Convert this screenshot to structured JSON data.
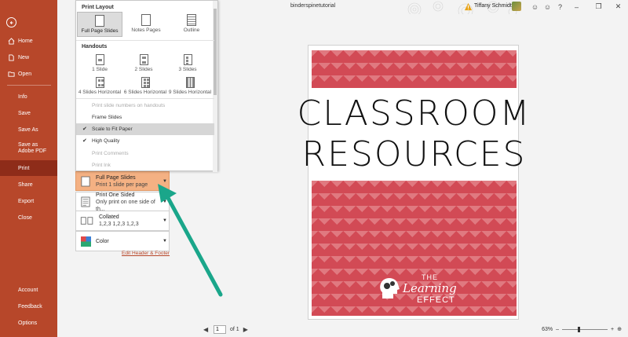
{
  "window": {
    "title": "binderspinetutorial",
    "user_name": "Tiffany Schmidt"
  },
  "sidebar": {
    "items": [
      {
        "label": "Home",
        "icon": "home-icon"
      },
      {
        "label": "New",
        "icon": "new-file-icon"
      },
      {
        "label": "Open",
        "icon": "folder-open-icon"
      },
      {
        "label": "Info"
      },
      {
        "label": "Save"
      },
      {
        "label": "Save As"
      },
      {
        "label": "Save as Adobe PDF"
      },
      {
        "label": "Print"
      },
      {
        "label": "Share"
      },
      {
        "label": "Export"
      },
      {
        "label": "Close"
      },
      {
        "label": "Account"
      },
      {
        "label": "Feedback"
      },
      {
        "label": "Options"
      }
    ],
    "active": "Print"
  },
  "dropdown": {
    "print_layout_heading": "Print Layout",
    "layouts": [
      "Full Page Slides",
      "Notes Pages",
      "Outline"
    ],
    "selected_layout": "Full Page Slides",
    "handouts_heading": "Handouts",
    "handouts": [
      "1 Slide",
      "2 Slides",
      "3 Slides",
      "4 Slides Horizontal",
      "6 Slides Horizontal",
      "9 Slides Horizontal"
    ],
    "options": [
      {
        "label": "Print slide numbers on handouts",
        "enabled": false,
        "checked": false
      },
      {
        "label": "Frame Slides",
        "enabled": true,
        "checked": false
      },
      {
        "label": "Scale to Fit Paper",
        "enabled": true,
        "checked": true,
        "highlighted": true
      },
      {
        "label": "High Quality",
        "enabled": true,
        "checked": true
      },
      {
        "label": "Print Comments",
        "enabled": false,
        "checked": false
      },
      {
        "label": "Print Ink",
        "enabled": false,
        "checked": false
      }
    ]
  },
  "settings": {
    "layout": {
      "title": "Full Page Slides",
      "sub": "Print 1 slide per page"
    },
    "sides": {
      "title": "Print One Sided",
      "sub": "Only print on one side of th..."
    },
    "collation": {
      "title": "Collated",
      "sub": "1,2,3    1,2,3    1,2,3"
    },
    "color": {
      "title": "Color"
    },
    "edit_header_footer": "Edit Header & Footer"
  },
  "preview": {
    "title_line1": "Classroom",
    "title_line2": "Resources",
    "logo_line1": "THE",
    "logo_line2": "Learning",
    "logo_line3": "EFFECT",
    "chevron_color": "#d24a55",
    "chevron_light": "#e07980"
  },
  "statusbar": {
    "page_value": "1",
    "page_of": "of 1",
    "zoom": "63%"
  },
  "colors": {
    "sidebar": "#b7472a",
    "sidebar_active": "#8e2c19",
    "selected_setting": "#f4b183",
    "annotation_arrow": "#1aa68a"
  }
}
